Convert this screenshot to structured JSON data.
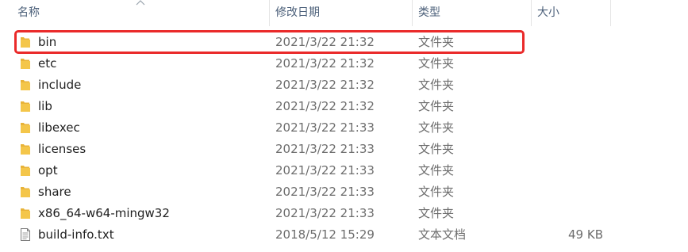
{
  "columns": {
    "name": "名称",
    "date": "修改日期",
    "type": "类型",
    "size": "大小"
  },
  "files": [
    {
      "name": "bin",
      "date": "2021/3/22 21:32",
      "type": "文件夹",
      "size": "",
      "icon": "folder-icon"
    },
    {
      "name": "etc",
      "date": "2021/3/22 21:32",
      "type": "文件夹",
      "size": "",
      "icon": "folder-icon"
    },
    {
      "name": "include",
      "date": "2021/3/22 21:32",
      "type": "文件夹",
      "size": "",
      "icon": "folder-icon"
    },
    {
      "name": "lib",
      "date": "2021/3/22 21:32",
      "type": "文件夹",
      "size": "",
      "icon": "folder-icon"
    },
    {
      "name": "libexec",
      "date": "2021/3/22 21:33",
      "type": "文件夹",
      "size": "",
      "icon": "folder-icon"
    },
    {
      "name": "licenses",
      "date": "2021/3/22 21:33",
      "type": "文件夹",
      "size": "",
      "icon": "folder-icon"
    },
    {
      "name": "opt",
      "date": "2021/3/22 21:33",
      "type": "文件夹",
      "size": "",
      "icon": "folder-icon"
    },
    {
      "name": "share",
      "date": "2021/3/22 21:33",
      "type": "文件夹",
      "size": "",
      "icon": "folder-icon"
    },
    {
      "name": "x86_64-w64-mingw32",
      "date": "2021/3/22 21:33",
      "type": "文件夹",
      "size": "",
      "icon": "folder-icon"
    },
    {
      "name": "build-info.txt",
      "date": "2018/5/12 15:29",
      "type": "文本文档",
      "size": "49 KB",
      "icon": "text-file-icon"
    }
  ],
  "colors": {
    "highlight": "#ea2a2a",
    "folder": "#f4c64a",
    "header_text": "#4c607a"
  }
}
